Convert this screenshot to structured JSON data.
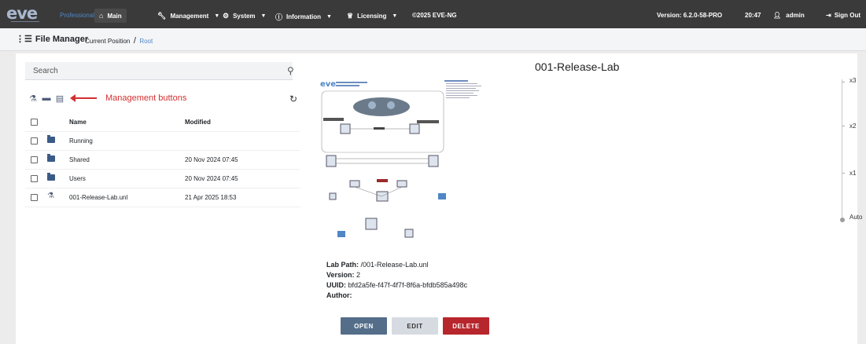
{
  "navbar": {
    "logo": "eve",
    "edition": "Professional",
    "items": [
      {
        "label": "Main",
        "icon": "home-icon"
      },
      {
        "label": "Management",
        "icon": "wrench-icon"
      },
      {
        "label": "System",
        "icon": "gear-icon"
      },
      {
        "label": "Information",
        "icon": "info-icon"
      },
      {
        "label": "Licensing",
        "icon": "license-icon"
      }
    ],
    "copyright": "©2025 EVE-NG",
    "version": "Version: 6.2.0-58-PRO",
    "time": "20:47",
    "user": "admin",
    "signout": "Sign Out"
  },
  "breadcrumb": {
    "title": "File Manager",
    "label": "Current Position",
    "separator": "/",
    "root": "Root"
  },
  "filelist": {
    "search_placeholder": "Search",
    "management_annotation": "Management buttons",
    "columns": {
      "name": "Name",
      "modified": "Modified"
    },
    "rows": [
      {
        "type": "folder",
        "name": "Running",
        "modified": ""
      },
      {
        "type": "folder",
        "name": "Shared",
        "modified": "20 Nov 2024 07:45"
      },
      {
        "type": "folder",
        "name": "Users",
        "modified": "20 Nov 2024 07:45"
      },
      {
        "type": "lab",
        "name": "001-Release-Lab.unl",
        "modified": "21 Apr 2025 18:53"
      }
    ]
  },
  "preview": {
    "title": "001-Release-Lab",
    "lab_path_label": "Lab Path:",
    "lab_path": "/001-Release-Lab.unl",
    "version_label": "Version:",
    "version": "2",
    "uuid_label": "UUID:",
    "uuid": "bfd2a5fe-f47f-4f7f-8f6a-bfdb585a498c",
    "author_label": "Author:",
    "author": "",
    "buttons": {
      "open": "OPEN",
      "edit": "EDIT",
      "delete": "DELETE"
    }
  },
  "zoom": {
    "levels": [
      "x3",
      "x2",
      "x1",
      "Auto"
    ],
    "selected": "Auto"
  },
  "colors": {
    "navbar": "#3a3a3a",
    "accent": "#4f86c6",
    "open": "#546e8a",
    "delete": "#b7262c",
    "annotation": "#d32f2f"
  }
}
